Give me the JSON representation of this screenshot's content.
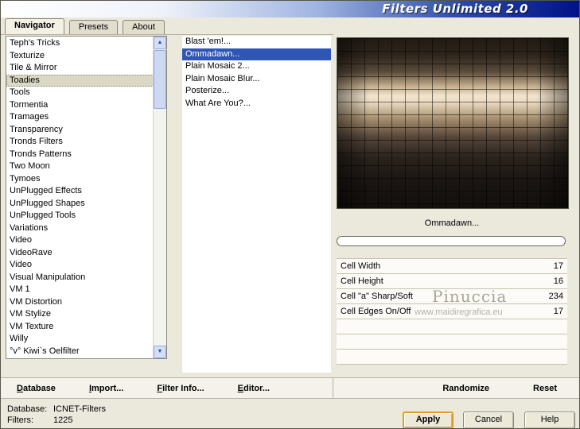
{
  "window": {
    "title": "Filters Unlimited 2.0"
  },
  "tabs": [
    {
      "label": "Navigator",
      "active": true
    },
    {
      "label": "Presets",
      "active": false
    },
    {
      "label": "About",
      "active": false
    }
  ],
  "categories": {
    "selected": "Toadies",
    "items": [
      "Teph's Tricks",
      "Texturize",
      "Tile & Mirror",
      "Toadies",
      "Tools",
      "Tormentia",
      "Tramages",
      "Transparency",
      "Tronds Filters",
      "Tronds Patterns",
      "Two Moon",
      "Tymoes",
      "UnPlugged Effects",
      "UnPlugged Shapes",
      "UnPlugged Tools",
      "Variations",
      "Video",
      "VideoRave",
      "Video",
      "Visual Manipulation",
      "VM 1",
      "VM Distortion",
      "VM Stylize",
      "VM Texture",
      "Willy",
      "°v° Kiwi`s Oelfilter"
    ]
  },
  "filters": {
    "selected": "Ommadawn...",
    "items": [
      "Blast 'em!...",
      "Ommadawn...",
      "Plain Mosaic 2...",
      "Plain Mosaic Blur...",
      "Posterize...",
      "What Are You?..."
    ]
  },
  "preview": {
    "filter_name": "Ommadawn...",
    "progress_percent": 0
  },
  "parameters": {
    "rows": [
      {
        "name": "Cell Width",
        "value": "17"
      },
      {
        "name": "Cell Height",
        "value": "16"
      },
      {
        "name": "Cell \"a\" Sharp/Soft",
        "value": "234"
      },
      {
        "name": "Cell Edges On/Off",
        "value": "17"
      }
    ],
    "empty_rows": 3
  },
  "watermark": {
    "line1": "Pinuccia",
    "line2": "www.maidiregrafica.eu"
  },
  "toolbar": {
    "left": [
      {
        "label": "Database"
      },
      {
        "label": "Import..."
      },
      {
        "label": "Filter Info..."
      },
      {
        "label": "Editor..."
      }
    ],
    "right": [
      {
        "label": "Randomize"
      },
      {
        "label": "Reset"
      }
    ]
  },
  "status": {
    "database_label": "Database:",
    "database_value": "ICNET-Filters",
    "filters_label": "Filters:",
    "filters_value": "1225"
  },
  "action_buttons": [
    {
      "label": "Apply",
      "primary": true
    },
    {
      "label": "Cancel",
      "primary": false
    },
    {
      "label": "Help",
      "primary": false
    }
  ],
  "colors": {
    "dialog_bg": "#ebe8dc",
    "titlebar_blue": "#001286",
    "selection_blue": "#2f55b5",
    "apply_highlight": "#e09a28"
  }
}
